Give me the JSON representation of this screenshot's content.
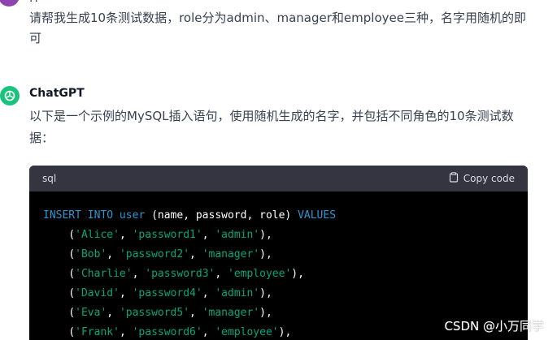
{
  "user": {
    "dots": "··",
    "message": "请帮我生成10条测试数据，role分为admin、manager和employee三种，名字用随机的即可"
  },
  "assistant": {
    "name": "ChatGPT",
    "text": "以下是一个示例的MySQL插入语句，使用随机生成的名字，并包括不同角色的10条测试数据："
  },
  "code_block": {
    "language": "sql",
    "copy_label": "Copy code",
    "line_first": {
      "kw1": "INSERT INTO",
      "table": "user",
      "cols": "(name, password, role)",
      "kw2": "VALUES"
    },
    "rows": [
      {
        "name": "'Alice'",
        "password": "'password1'",
        "role": "'admin'"
      },
      {
        "name": "'Bob'",
        "password": "'password2'",
        "role": "'manager'"
      },
      {
        "name": "'Charlie'",
        "password": "'password3'",
        "role": "'employee'"
      },
      {
        "name": "'David'",
        "password": "'password4'",
        "role": "'admin'"
      },
      {
        "name": "'Eva'",
        "password": "'password5'",
        "role": "'manager'"
      },
      {
        "name": "'Frank'",
        "password": "'password6'",
        "role": "'employee'"
      }
    ]
  },
  "watermark": "CSDN @小万同学",
  "colors": {
    "accent_green": "#19c37d",
    "code_keyword": "#2e95d3",
    "code_string": "#00a67d",
    "code_bg": "#000000",
    "code_header_bg": "#343541"
  },
  "icons": {
    "assistant": "openai-logo-icon",
    "copy": "clipboard-icon"
  }
}
